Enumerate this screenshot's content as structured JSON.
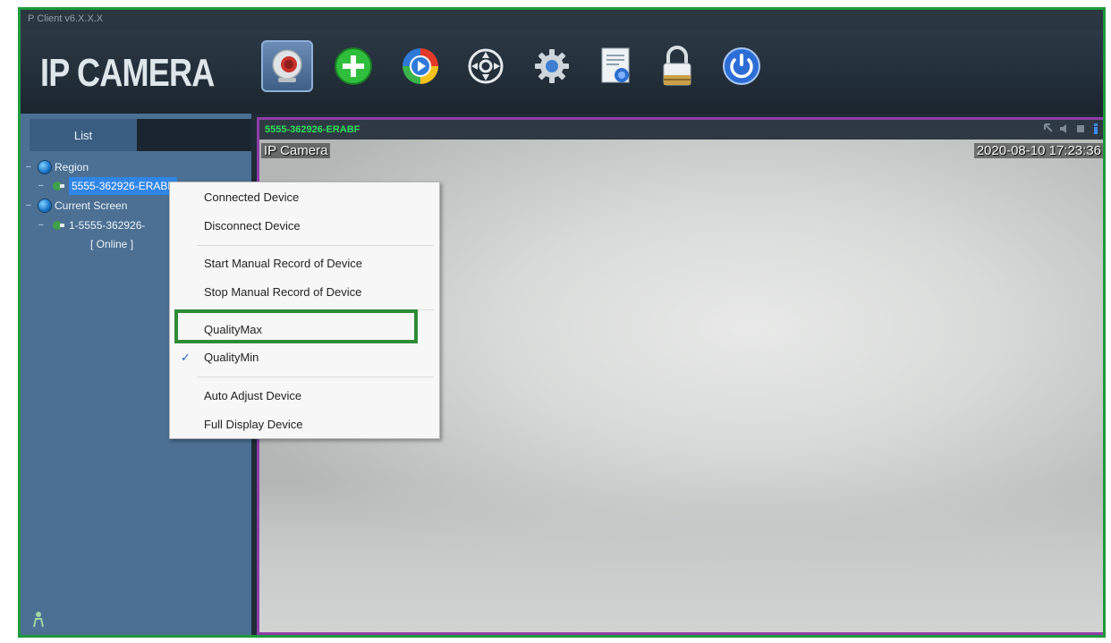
{
  "window": {
    "title": "P Client v6.X.X.X"
  },
  "logo": {
    "text": "IP CAMERA"
  },
  "toolbar": {
    "buttons": [
      {
        "icon": "webcam-icon"
      },
      {
        "icon": "add-icon"
      },
      {
        "icon": "playback-icon"
      },
      {
        "icon": "ptz-control-icon"
      },
      {
        "icon": "settings-icon"
      },
      {
        "icon": "log-icon"
      },
      {
        "icon": "lock-icon"
      },
      {
        "icon": "power-icon"
      }
    ]
  },
  "sidebar": {
    "tab_label": "List",
    "tree": {
      "region": "Region",
      "region_device": "5555-362926-ERABF",
      "current_screen": "Current Screen",
      "screen_device": "1-5555-362926-",
      "status": "[  Online  ]"
    }
  },
  "video": {
    "device_title": "5555-362926-ERABF",
    "osd_name": "IP Camera",
    "osd_time": "2020-08-10 17:23:36"
  },
  "context_menu": {
    "items": [
      {
        "label": "Connected Device",
        "checked": false
      },
      {
        "label": "Disconnect Device",
        "checked": false
      },
      {
        "label": "Start Manual Record of Device",
        "checked": false
      },
      {
        "label": "Stop Manual Record of Device",
        "checked": false
      },
      {
        "label": "QualityMax",
        "checked": false,
        "highlighted": true
      },
      {
        "label": "QualityMin",
        "checked": true
      },
      {
        "label": "Auto Adjust Device",
        "checked": false
      },
      {
        "label": "Full Display Device",
        "checked": false
      }
    ],
    "check_mark": "✓"
  },
  "colors": {
    "frame_border": "#1e9a3c",
    "panel_border": "#8e3da8",
    "sidebar": "#4b7094",
    "highlight": "#2e8b36",
    "device_title": "#2fe05a"
  }
}
